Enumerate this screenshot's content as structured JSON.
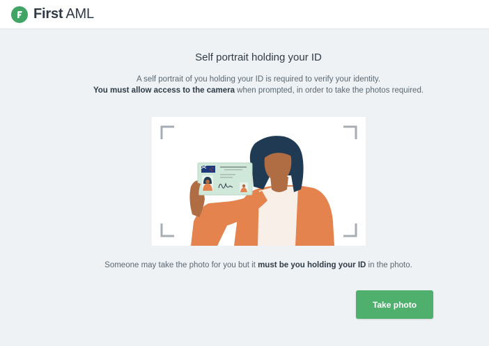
{
  "header": {
    "logo_bold": "First",
    "logo_light": "AML"
  },
  "main": {
    "title": "Self portrait holding your ID",
    "description_line1": "A self portrait of you holding your ID is required to verify your identity.",
    "description_line2_bold": "You must allow access to the camera",
    "description_line2_rest": " when prompted, in order to take the photos required.",
    "note_prefix": "Someone may take the photo for you but it ",
    "note_bold": "must be you holding your ID",
    "note_suffix": " in the photo.",
    "button_label": "Take photo"
  },
  "colors": {
    "accent_green": "#4fb06e",
    "logo_green": "#3fa464",
    "background": "#eef2f5"
  },
  "icons": {
    "logo": "first-aml-logo-icon",
    "illustration": "person-holding-id-illustration"
  }
}
